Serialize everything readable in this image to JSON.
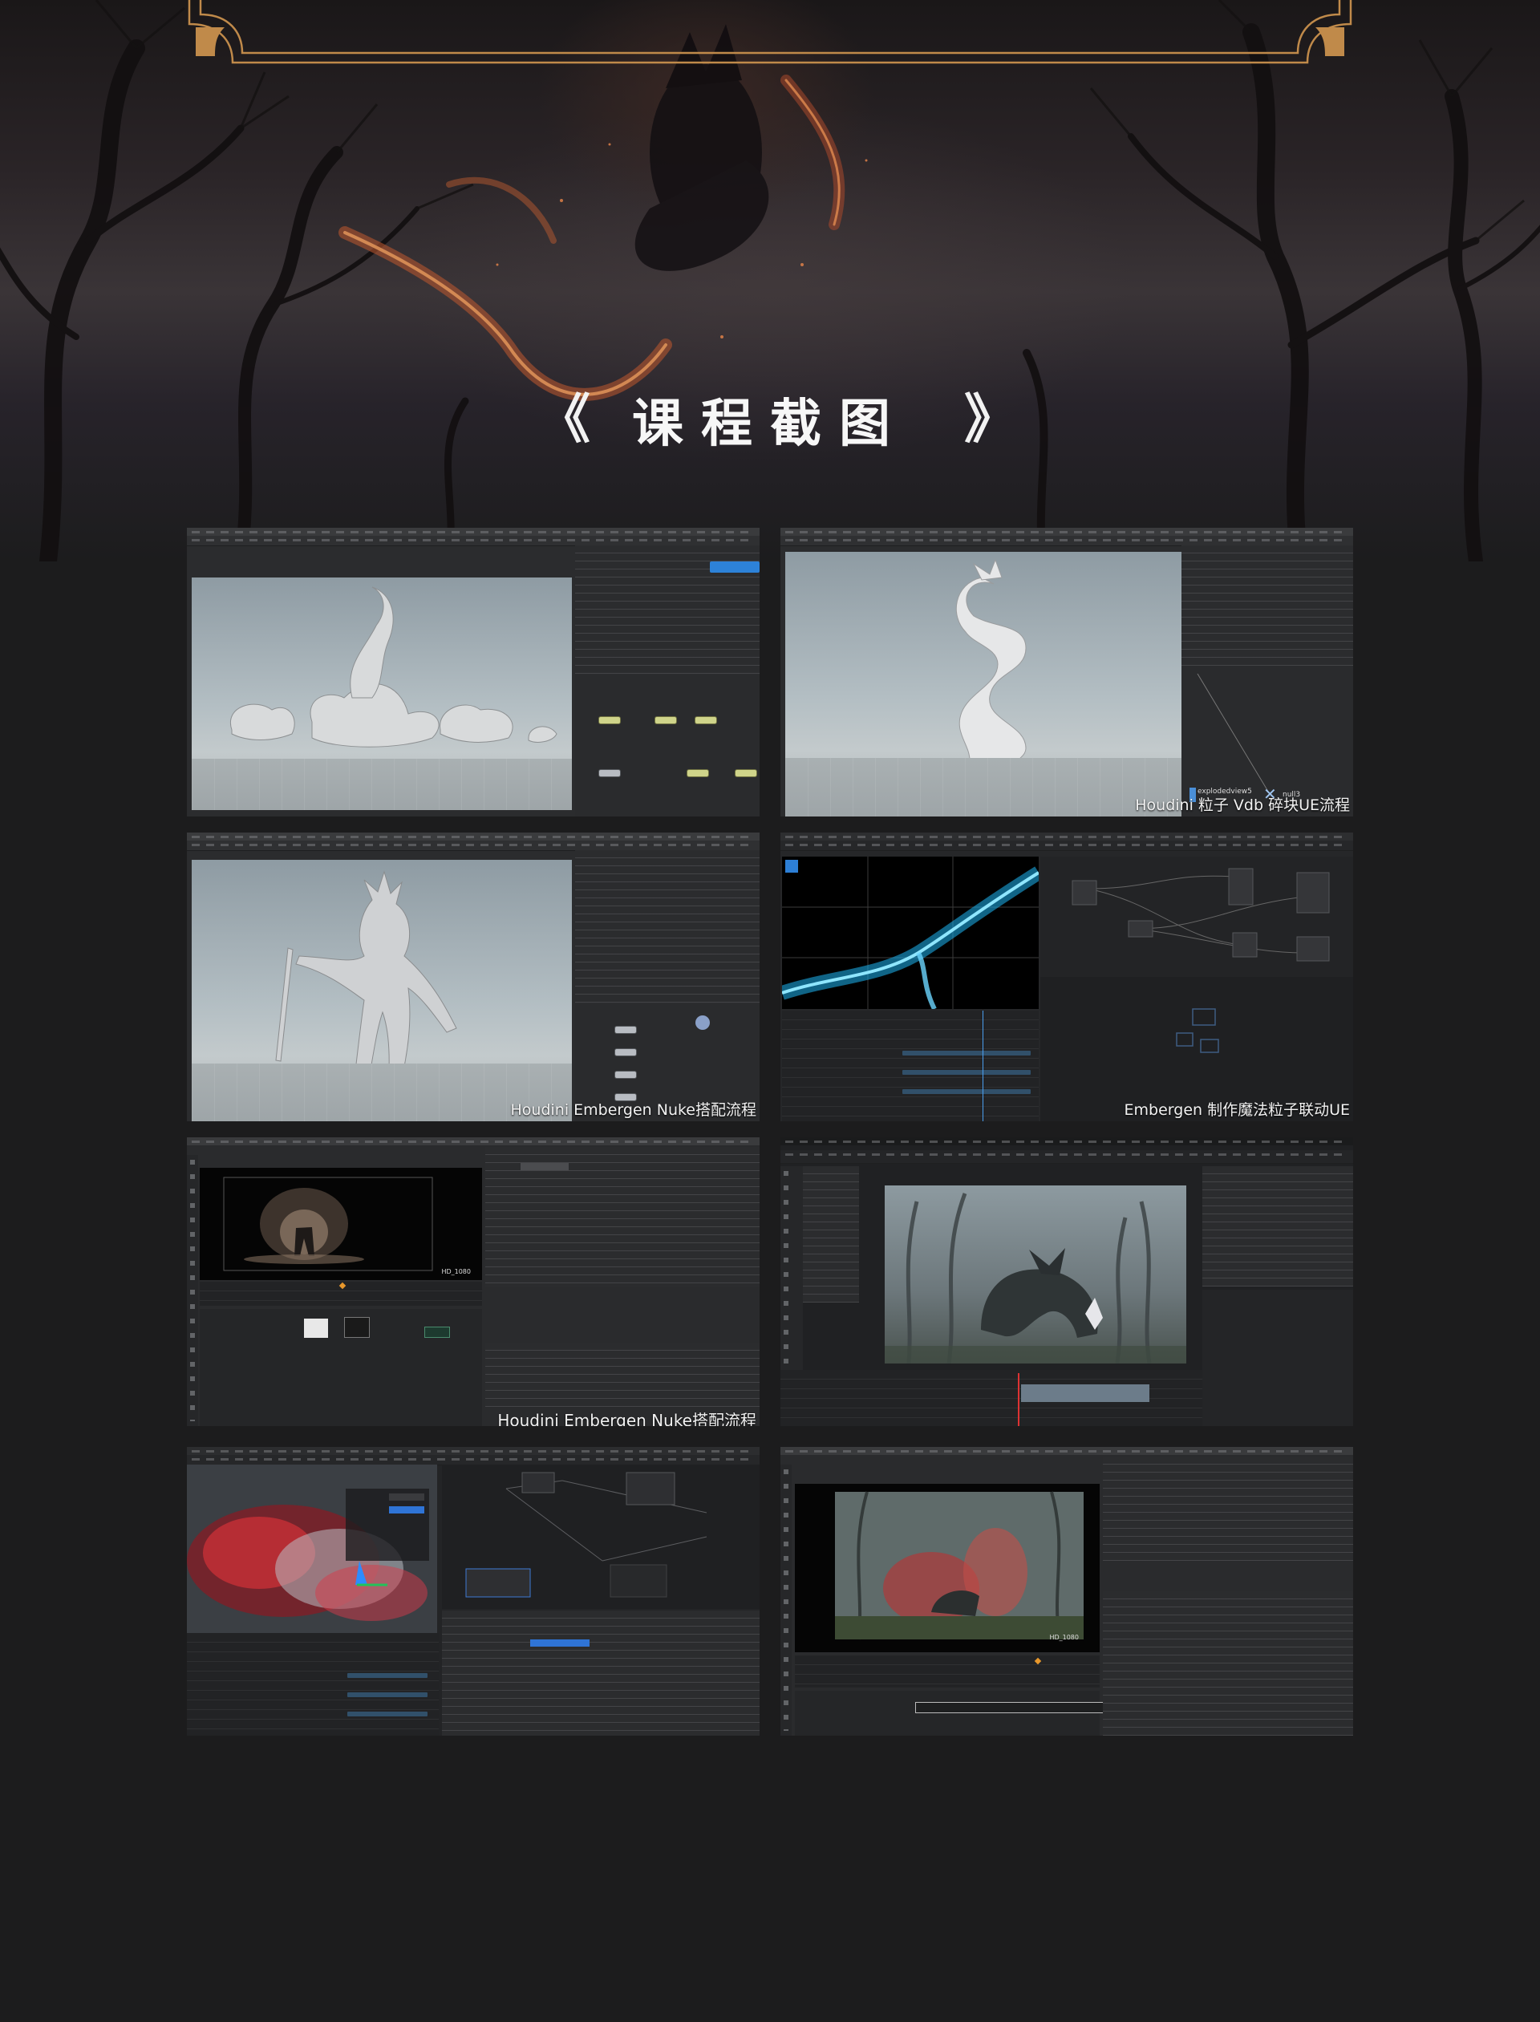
{
  "section": {
    "title": "课程截图",
    "left_chevron": "《",
    "right_chevron": "》"
  },
  "colors": {
    "background": "#1c1c1d",
    "frame_gold": "#c08a4a",
    "title_text": "#f7f7f7"
  },
  "screenshots": [
    {
      "name": "houdini-scene-sculptures",
      "caption": ""
    },
    {
      "name": "houdini-dragon-sculpture",
      "caption": "Houdini 粒子 Vdb 碎块UE流程",
      "nodes": [
        "explodedview5",
        "null3"
      ]
    },
    {
      "name": "houdini-warrior-sculpture",
      "caption": "Houdini Embergen Nuke搭配流程"
    },
    {
      "name": "embergen-lightning",
      "caption": "Embergen 制作魔法粒子联动UE"
    },
    {
      "name": "nuke-glow-comp",
      "caption": "Houdini Embergen Nuke搭配流程",
      "viewer_label": "HD_1080"
    },
    {
      "name": "ue-forest-creature",
      "caption": ""
    },
    {
      "name": "embergen-red-smoke",
      "caption": ""
    },
    {
      "name": "nuke-forest-smoke",
      "caption": "",
      "viewer_label": "HD_1080"
    }
  ]
}
